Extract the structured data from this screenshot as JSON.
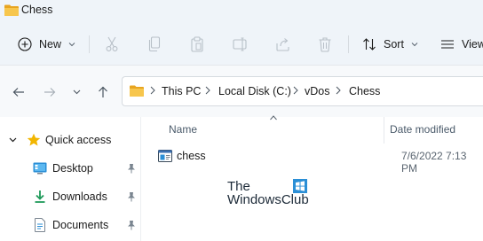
{
  "window": {
    "title": "Chess"
  },
  "toolbar": {
    "new_label": "New",
    "sort_label": "Sort",
    "view_label": "View"
  },
  "address": {
    "crumbs": [
      "This PC",
      "Local Disk (C:)",
      "vDos",
      "Chess"
    ]
  },
  "nav_pane": {
    "items": [
      {
        "label": "Quick access",
        "icon": "star-icon",
        "expanded": true
      },
      {
        "label": "Desktop",
        "icon": "desktop-icon",
        "pinned": true
      },
      {
        "label": "Downloads",
        "icon": "download-icon",
        "pinned": true
      },
      {
        "label": "Documents",
        "icon": "document-icon",
        "pinned": true
      }
    ]
  },
  "columns": {
    "name": "Name",
    "date_modified": "Date modified"
  },
  "files": [
    {
      "name": "chess",
      "date_modified": "7/6/2022 7:13 PM",
      "icon": "application-icon"
    }
  ],
  "watermark": {
    "line1": "The",
    "line2": "WindowsClub"
  },
  "colors": {
    "accent": "#0067c0",
    "folder": "#f5c14a",
    "star": "#f2b600",
    "chrome": "#eff4f9"
  }
}
